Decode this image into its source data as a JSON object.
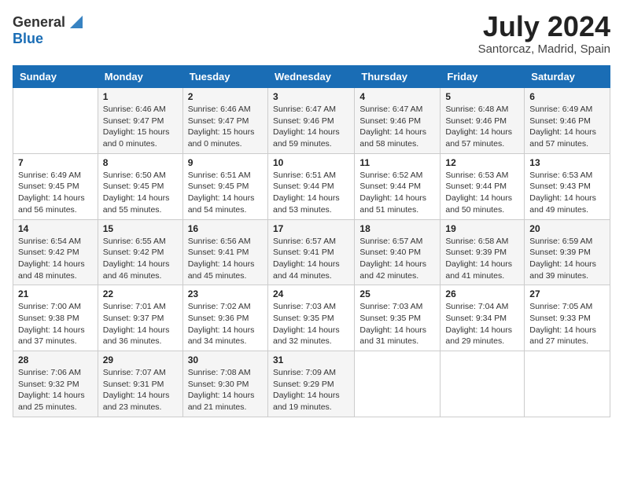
{
  "logo": {
    "general": "General",
    "blue": "Blue"
  },
  "title": "July 2024",
  "location": "Santorcaz, Madrid, Spain",
  "header_days": [
    "Sunday",
    "Monday",
    "Tuesday",
    "Wednesday",
    "Thursday",
    "Friday",
    "Saturday"
  ],
  "weeks": [
    [
      {
        "day": "",
        "detail": ""
      },
      {
        "day": "1",
        "detail": "Sunrise: 6:46 AM\nSunset: 9:47 PM\nDaylight: 15 hours and 0 minutes."
      },
      {
        "day": "2",
        "detail": "Sunrise: 6:46 AM\nSunset: 9:47 PM\nDaylight: 15 hours and 0 minutes."
      },
      {
        "day": "3",
        "detail": "Sunrise: 6:47 AM\nSunset: 9:46 PM\nDaylight: 14 hours and 59 minutes."
      },
      {
        "day": "4",
        "detail": "Sunrise: 6:47 AM\nSunset: 9:46 PM\nDaylight: 14 hours and 58 minutes."
      },
      {
        "day": "5",
        "detail": "Sunrise: 6:48 AM\nSunset: 9:46 PM\nDaylight: 14 hours and 57 minutes."
      },
      {
        "day": "6",
        "detail": "Sunrise: 6:49 AM\nSunset: 9:46 PM\nDaylight: 14 hours and 57 minutes."
      }
    ],
    [
      {
        "day": "7",
        "detail": "Sunrise: 6:49 AM\nSunset: 9:45 PM\nDaylight: 14 hours and 56 minutes."
      },
      {
        "day": "8",
        "detail": "Sunrise: 6:50 AM\nSunset: 9:45 PM\nDaylight: 14 hours and 55 minutes."
      },
      {
        "day": "9",
        "detail": "Sunrise: 6:51 AM\nSunset: 9:45 PM\nDaylight: 14 hours and 54 minutes."
      },
      {
        "day": "10",
        "detail": "Sunrise: 6:51 AM\nSunset: 9:44 PM\nDaylight: 14 hours and 53 minutes."
      },
      {
        "day": "11",
        "detail": "Sunrise: 6:52 AM\nSunset: 9:44 PM\nDaylight: 14 hours and 51 minutes."
      },
      {
        "day": "12",
        "detail": "Sunrise: 6:53 AM\nSunset: 9:44 PM\nDaylight: 14 hours and 50 minutes."
      },
      {
        "day": "13",
        "detail": "Sunrise: 6:53 AM\nSunset: 9:43 PM\nDaylight: 14 hours and 49 minutes."
      }
    ],
    [
      {
        "day": "14",
        "detail": "Sunrise: 6:54 AM\nSunset: 9:42 PM\nDaylight: 14 hours and 48 minutes."
      },
      {
        "day": "15",
        "detail": "Sunrise: 6:55 AM\nSunset: 9:42 PM\nDaylight: 14 hours and 46 minutes."
      },
      {
        "day": "16",
        "detail": "Sunrise: 6:56 AM\nSunset: 9:41 PM\nDaylight: 14 hours and 45 minutes."
      },
      {
        "day": "17",
        "detail": "Sunrise: 6:57 AM\nSunset: 9:41 PM\nDaylight: 14 hours and 44 minutes."
      },
      {
        "day": "18",
        "detail": "Sunrise: 6:57 AM\nSunset: 9:40 PM\nDaylight: 14 hours and 42 minutes."
      },
      {
        "day": "19",
        "detail": "Sunrise: 6:58 AM\nSunset: 9:39 PM\nDaylight: 14 hours and 41 minutes."
      },
      {
        "day": "20",
        "detail": "Sunrise: 6:59 AM\nSunset: 9:39 PM\nDaylight: 14 hours and 39 minutes."
      }
    ],
    [
      {
        "day": "21",
        "detail": "Sunrise: 7:00 AM\nSunset: 9:38 PM\nDaylight: 14 hours and 37 minutes."
      },
      {
        "day": "22",
        "detail": "Sunrise: 7:01 AM\nSunset: 9:37 PM\nDaylight: 14 hours and 36 minutes."
      },
      {
        "day": "23",
        "detail": "Sunrise: 7:02 AM\nSunset: 9:36 PM\nDaylight: 14 hours and 34 minutes."
      },
      {
        "day": "24",
        "detail": "Sunrise: 7:03 AM\nSunset: 9:35 PM\nDaylight: 14 hours and 32 minutes."
      },
      {
        "day": "25",
        "detail": "Sunrise: 7:03 AM\nSunset: 9:35 PM\nDaylight: 14 hours and 31 minutes."
      },
      {
        "day": "26",
        "detail": "Sunrise: 7:04 AM\nSunset: 9:34 PM\nDaylight: 14 hours and 29 minutes."
      },
      {
        "day": "27",
        "detail": "Sunrise: 7:05 AM\nSunset: 9:33 PM\nDaylight: 14 hours and 27 minutes."
      }
    ],
    [
      {
        "day": "28",
        "detail": "Sunrise: 7:06 AM\nSunset: 9:32 PM\nDaylight: 14 hours and 25 minutes."
      },
      {
        "day": "29",
        "detail": "Sunrise: 7:07 AM\nSunset: 9:31 PM\nDaylight: 14 hours and 23 minutes."
      },
      {
        "day": "30",
        "detail": "Sunrise: 7:08 AM\nSunset: 9:30 PM\nDaylight: 14 hours and 21 minutes."
      },
      {
        "day": "31",
        "detail": "Sunrise: 7:09 AM\nSunset: 9:29 PM\nDaylight: 14 hours and 19 minutes."
      },
      {
        "day": "",
        "detail": ""
      },
      {
        "day": "",
        "detail": ""
      },
      {
        "day": "",
        "detail": ""
      }
    ]
  ]
}
